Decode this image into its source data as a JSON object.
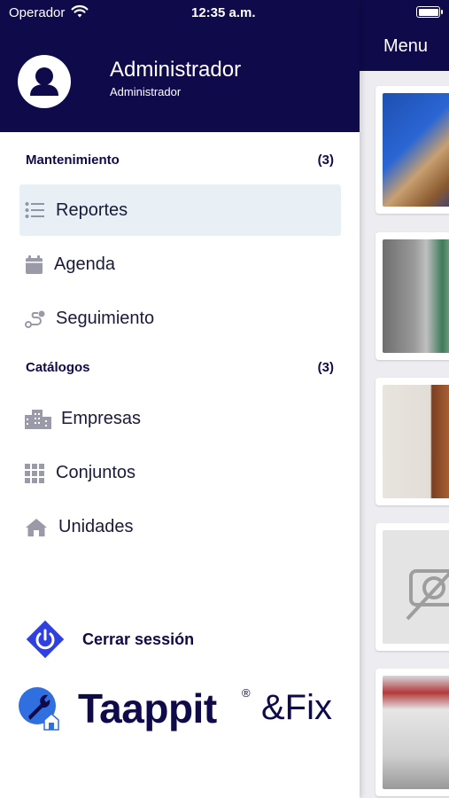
{
  "status_bar": {
    "carrier": "Operador",
    "time": "12:35 a.m."
  },
  "background": {
    "title": "Menu"
  },
  "user": {
    "name": "Administrador",
    "role": "Administrador"
  },
  "sections": [
    {
      "title": "Mantenimiento",
      "count": "(3)"
    },
    {
      "title": "Catálogos",
      "count": "(3)"
    }
  ],
  "menu": {
    "reportes": "Reportes",
    "agenda": "Agenda",
    "seguimiento": "Seguimiento",
    "empresas": "Empresas",
    "conjuntos": "Conjuntos",
    "unidades": "Unidades"
  },
  "logout_label": "Cerrar sessión",
  "brand": {
    "name": "Taappit",
    "registered": "®",
    "suffix": "&Fix"
  },
  "colors": {
    "primary": "#0f0a4a",
    "accent": "#2f3fe0",
    "active_bg": "#e9f0f5",
    "icon_gray": "#9a9aa8"
  },
  "icons": {
    "reportes": "list-icon",
    "agenda": "calendar-icon",
    "seguimiento": "route-icon",
    "empresas": "building-icon",
    "conjuntos": "grid-icon",
    "unidades": "home-icon",
    "logout": "power-icon",
    "avatar": "user-icon"
  }
}
